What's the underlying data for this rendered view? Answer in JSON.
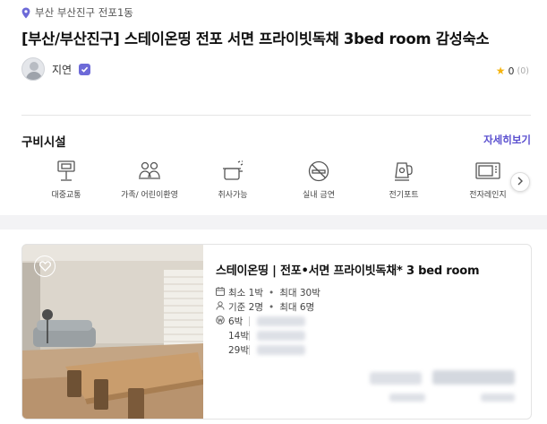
{
  "location": {
    "icon": "location-pin-icon",
    "text": "부산 부산진구 전포1동"
  },
  "title": "[부산/부산진구] 스테이온띵 전포 서면 프라이빗독채 3bed room 감성숙소",
  "host": {
    "name": "지연",
    "verified_icon": "verified-badge-icon"
  },
  "rating": {
    "score": "0",
    "count": "(0)"
  },
  "amenities": {
    "section_title": "구비시설",
    "more_label": "자세히보기",
    "items": [
      {
        "icon": "public-transit-icon",
        "label": "대중교통"
      },
      {
        "icon": "family-icon",
        "label": "가족/ 어린이환영"
      },
      {
        "icon": "cooking-pot-icon",
        "label": "취사가능"
      },
      {
        "icon": "no-smoking-icon",
        "label": "실내 금연"
      },
      {
        "icon": "electric-kettle-icon",
        "label": "전기포트"
      },
      {
        "icon": "microwave-icon",
        "label": "전자레인지"
      }
    ]
  },
  "room": {
    "title": "스테이온띵 | 전포•서면 프라이빗독채* 3 bed room",
    "nights_min": "최소 1박",
    "nights_max": "최대 30박",
    "guests_base": "기준 2명",
    "guests_max": "최대 6명",
    "stays": [
      "6박",
      "14박",
      "29박"
    ]
  },
  "colors": {
    "accent": "#5a4fcf",
    "star": "#f5b40f",
    "pin": "#6d6ad8"
  }
}
